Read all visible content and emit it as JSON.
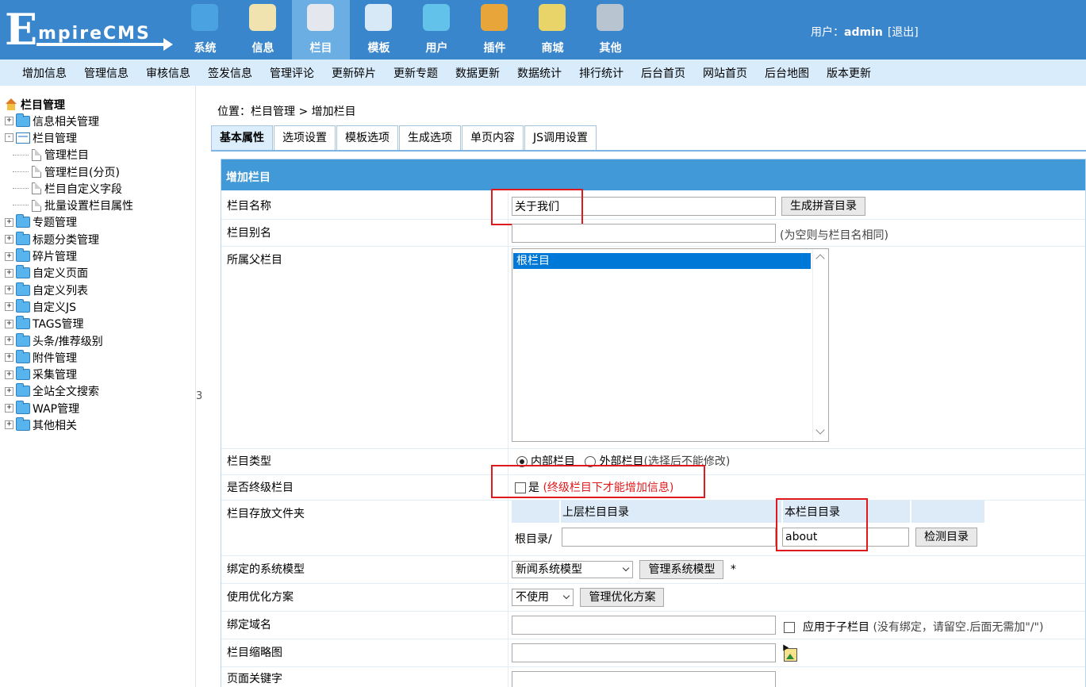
{
  "header": {
    "logo_initial": "E",
    "logo_rest": "mpireCMS",
    "nav": [
      {
        "label": "系统",
        "icon": "globe-icon",
        "color": "#4aa3e0"
      },
      {
        "label": "信息",
        "icon": "notepad-icon",
        "color": "#f1e3b0"
      },
      {
        "label": "栏目",
        "icon": "folder-icon",
        "color": "#e4e8ee"
      },
      {
        "label": "模板",
        "icon": "window-icon",
        "color": "#d7e9f7"
      },
      {
        "label": "用户",
        "icon": "user-icon",
        "color": "#63c2ea"
      },
      {
        "label": "插件",
        "icon": "tools-icon",
        "color": "#e8a63a"
      },
      {
        "label": "商城",
        "icon": "card-icon",
        "color": "#e9d46a"
      },
      {
        "label": "其他",
        "icon": "gear-icon",
        "color": "#b8c4cf"
      }
    ],
    "active_nav": "栏目",
    "user_label": "用户：",
    "user_name": "admin",
    "logout": "[退出]"
  },
  "subnav": [
    "增加信息",
    "管理信息",
    "审核信息",
    "签发信息",
    "管理评论",
    "更新碎片",
    "更新专题",
    "数据更新",
    "数据统计",
    "排行统计",
    "后台首页",
    "网站首页",
    "后台地图",
    "版本更新"
  ],
  "sidebar": {
    "root": "栏目管理",
    "items": [
      {
        "label": "信息相关管理",
        "exp": "+",
        "type": "folder"
      },
      {
        "label": "栏目管理",
        "exp": "-",
        "type": "open"
      },
      {
        "label": "管理栏目",
        "type": "page"
      },
      {
        "label": "管理栏目(分页)",
        "type": "page"
      },
      {
        "label": "栏目自定义字段",
        "type": "page"
      },
      {
        "label": "批量设置栏目属性",
        "type": "page"
      },
      {
        "label": "专题管理",
        "exp": "+",
        "type": "folder"
      },
      {
        "label": "标题分类管理",
        "exp": "+",
        "type": "folder"
      },
      {
        "label": "碎片管理",
        "exp": "+",
        "type": "folder"
      },
      {
        "label": "自定义页面",
        "exp": "+",
        "type": "folder"
      },
      {
        "label": "自定义列表",
        "exp": "+",
        "type": "folder"
      },
      {
        "label": "自定义JS",
        "exp": "+",
        "type": "folder"
      },
      {
        "label": "TAGS管理",
        "exp": "+",
        "type": "folder"
      },
      {
        "label": "头条/推荐级别",
        "exp": "+",
        "type": "folder"
      },
      {
        "label": "附件管理",
        "exp": "+",
        "type": "folder"
      },
      {
        "label": "采集管理",
        "exp": "+",
        "type": "folder"
      },
      {
        "label": "全站全文搜索",
        "exp": "+",
        "type": "folder"
      },
      {
        "label": "WAP管理",
        "exp": "+",
        "type": "folder"
      },
      {
        "label": "其他相关",
        "exp": "+",
        "type": "folder"
      }
    ],
    "splitter_glyph": "3"
  },
  "breadcrumb": {
    "prefix": "位置：",
    "link": "栏目管理",
    "sep": " > ",
    "current": "增加栏目"
  },
  "tabs": [
    "基本属性",
    "选项设置",
    "模板选项",
    "生成选项",
    "单页内容",
    "JS调用设置"
  ],
  "form": {
    "title": "增加栏目",
    "name_label": "栏目名称",
    "name_value": "关于我们",
    "pinyin_button": "生成拼音目录",
    "alias_label": "栏目别名",
    "alias_value": "",
    "alias_hint": "(为空则与栏目名相同)",
    "parent_label": "所属父栏目",
    "parent_option": "根栏目",
    "type_label": "栏目类型",
    "type_internal": "内部栏目",
    "type_external": "外部栏目",
    "type_hint": "(选择后不能修改)",
    "final_label": "是否终级栏目",
    "final_yes": "是",
    "final_hint": "(终级栏目下才能增加信息)",
    "folder_label": "栏目存放文件夹",
    "upper_dir_header": "上层栏目目录",
    "this_dir_header": "本栏目目录",
    "root_dir": "根目录/",
    "upper_dir_value": "",
    "this_dir_value": "about",
    "check_dir_button": "检测目录",
    "model_label": "绑定的系统模型",
    "model_value": "新闻系统模型",
    "model_button": "管理系统模型",
    "model_required": "*",
    "seo_label": "使用优化方案",
    "seo_value": "不使用",
    "seo_button": "管理优化方案",
    "domain_label": "绑定域名",
    "domain_value": "",
    "domain_apply": "应用于子栏目",
    "domain_hint": "(没有绑定，请留空.后面无需加\"/\")",
    "thumb_label": "栏目缩略图",
    "thumb_value": "",
    "keywords_label": "页面关键字",
    "keywords_value": ""
  }
}
